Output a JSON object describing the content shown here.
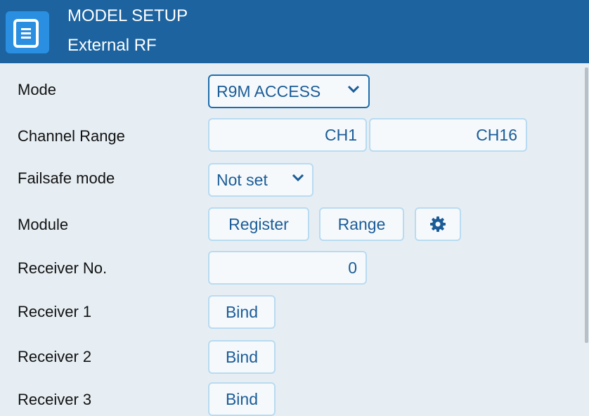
{
  "header": {
    "title": "MODEL SETUP",
    "subtitle": "External RF",
    "menu_icon": "menu-icon"
  },
  "colors": {
    "header_bg": "#1c63a0",
    "menu_button": "#2a8fe0",
    "body_bg": "#e6eef4",
    "field_text": "#1b5c97"
  },
  "rows": {
    "mode": {
      "label": "Mode",
      "value": "R9M ACCESS"
    },
    "channel_range": {
      "label": "Channel Range",
      "start": "CH1",
      "end": "CH16"
    },
    "failsafe": {
      "label": "Failsafe mode",
      "value": "Not set"
    },
    "module": {
      "label": "Module",
      "register": "Register",
      "range": "Range",
      "settings_icon": "gear-icon"
    },
    "receiver_no": {
      "label": "Receiver No.",
      "value": "0"
    },
    "receiver1": {
      "label": "Receiver 1",
      "bind": "Bind"
    },
    "receiver2": {
      "label": "Receiver 2",
      "bind": "Bind"
    },
    "receiver3": {
      "label": "Receiver 3",
      "bind": "Bind"
    }
  }
}
